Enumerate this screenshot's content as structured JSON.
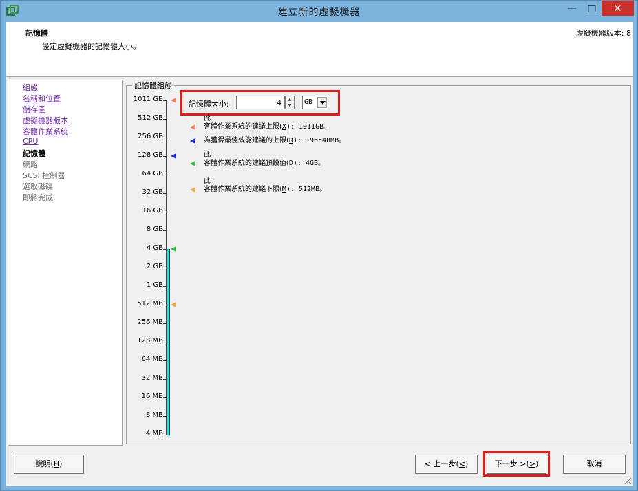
{
  "window": {
    "title": "建立新的虛擬機器",
    "minimize_glyph": "—",
    "maximize_glyph": "□",
    "close_glyph": "✕"
  },
  "header": {
    "title": "記憶體",
    "subtitle": "設定虛擬機器的記憶體大小。",
    "version": "虛擬機器版本: 8"
  },
  "sidebar": {
    "items": [
      {
        "label": "組態",
        "state": "link"
      },
      {
        "label": "名稱和位置",
        "state": "link"
      },
      {
        "label": "儲存區",
        "state": "link"
      },
      {
        "label": "虛擬機器版本",
        "state": "link"
      },
      {
        "label": "客體作業系統",
        "state": "link"
      },
      {
        "label": "CPU",
        "state": "link"
      },
      {
        "label": "記憶體",
        "state": "active"
      },
      {
        "label": "網路",
        "state": "disabled"
      },
      {
        "label": "SCSI 控制器",
        "state": "disabled"
      },
      {
        "label": "選取磁碟",
        "state": "disabled"
      },
      {
        "label": "即將完成",
        "state": "disabled"
      }
    ]
  },
  "memory": {
    "group_label": "記憶體組態",
    "size_label": "記憶體大小:",
    "size_value": "4",
    "unit_value": "GB",
    "scale_labels": [
      "1011 GB",
      "512 GB",
      "256 GB",
      "128 GB",
      "64 GB",
      "32 GB",
      "16 GB",
      "8 GB",
      "4 GB",
      "2 GB",
      "1 GB",
      "512 MB",
      "256 MB",
      "128 MB",
      "64 MB",
      "32 MB",
      "16 MB",
      "8 MB",
      "4 MB"
    ],
    "current_tick_index": 8,
    "markers": [
      {
        "name": "max-recommended",
        "tick_index": 0,
        "color": "#e8806a"
      },
      {
        "name": "best-performance",
        "tick_index": 3,
        "color": "#1a2fd6"
      },
      {
        "name": "default",
        "tick_index": 8,
        "color": "#3cb043"
      },
      {
        "name": "min-recommended",
        "tick_index": 11,
        "color": "#e8a960"
      }
    ],
    "legend": [
      {
        "prefix": "此",
        "text": "客體作業系統的建議上限(",
        "key": "X",
        "tail": "): 1011GB。",
        "color": "#e8806a"
      },
      {
        "prefix": "",
        "text": "為獲得最佳效能建議的上限(",
        "key": "R",
        "tail": "): 196548MB。",
        "color": "#1a2fd6"
      },
      {
        "prefix": "此",
        "text": "客體作業系統的建議預設值(",
        "key": "D",
        "tail": "): 4GB。",
        "color": "#3cb043"
      },
      {
        "prefix": "此",
        "text": "客體作業系統的建議下限(",
        "key": "M",
        "tail": "): 512MB。",
        "color": "#e8a960"
      }
    ],
    "highlight_color": "#e01b1b"
  },
  "footer": {
    "help": {
      "text": "說明(",
      "key": "H",
      "tail": ")"
    },
    "back": {
      "text": "< 上一步(",
      "key": "<",
      "tail": ")"
    },
    "next": {
      "text": "下一步 >(",
      "key": ">",
      "tail": ")"
    },
    "cancel": "取消"
  }
}
